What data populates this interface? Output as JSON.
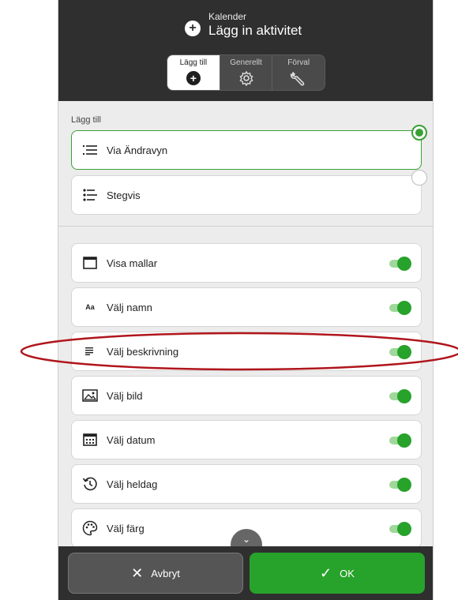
{
  "header": {
    "app_title": "Kalender",
    "screen_title": "Lägg in aktivitet",
    "plus_icon": "plus-circle-icon"
  },
  "tabs": [
    {
      "label": "Lägg till",
      "icon": "plus-circle-icon",
      "active": true
    },
    {
      "label": "Generellt",
      "icon": "gear-icon",
      "active": false
    },
    {
      "label": "Förval",
      "icon": "wrench-icon",
      "active": false
    }
  ],
  "add_section": {
    "label": "Lägg till",
    "options": [
      {
        "label": "Via Ändravyn",
        "icon": "list-icon",
        "selected": true
      },
      {
        "label": "Stegvis",
        "icon": "steps-icon",
        "selected": false
      }
    ]
  },
  "settings": [
    {
      "label": "Visa mallar",
      "icon": "calendar-icon",
      "on": true
    },
    {
      "label": "Välj namn",
      "icon": "text-aa-icon",
      "on": true
    },
    {
      "label": "Välj beskrivning",
      "icon": "description-lines-icon",
      "on": true
    },
    {
      "label": "Välj bild",
      "icon": "image-icon",
      "on": true
    },
    {
      "label": "Välj datum",
      "icon": "date-grid-icon",
      "on": true
    },
    {
      "label": "Välj heldag",
      "icon": "history-clock-icon",
      "on": true
    },
    {
      "label": "Välj färg",
      "icon": "palette-icon",
      "on": true
    }
  ],
  "footer": {
    "cancel_label": "Avbryt",
    "ok_label": "OK"
  },
  "colors": {
    "accent_green": "#27a22b",
    "dark_bar": "#2f2f2f",
    "highlight_red": "#b0151c"
  }
}
